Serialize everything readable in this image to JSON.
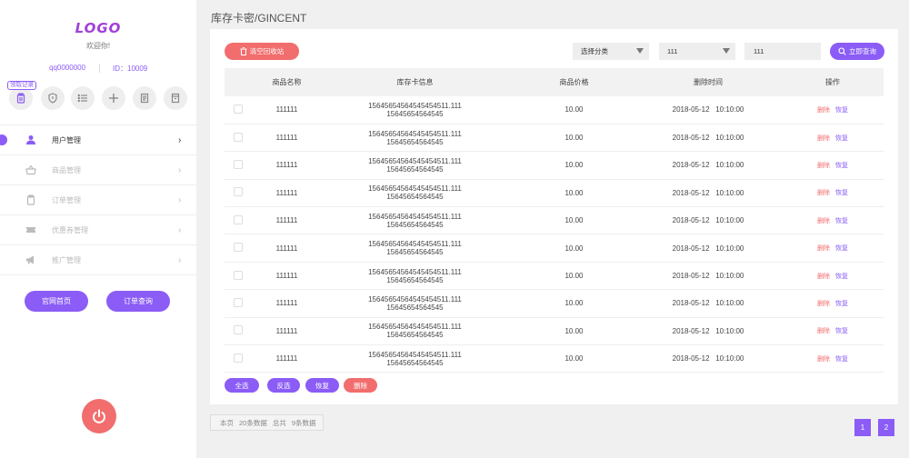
{
  "sidebar": {
    "logo": "LOGO",
    "welcome": "欢迎你!",
    "username": "qq0000000",
    "user_id": "ID：10009",
    "icon_badge": "领取记录",
    "icons": [
      "clipboard-icon",
      "shield-icon",
      "list-icon",
      "plus-icon",
      "document-icon",
      "bookmark-icon"
    ],
    "menu": [
      {
        "label": "用户管理",
        "icon": "user-icon",
        "active": true
      },
      {
        "label": "商品管理",
        "icon": "basket-icon",
        "active": false
      },
      {
        "label": "订单管理",
        "icon": "clipboard-icon",
        "active": false
      },
      {
        "label": "优惠券管理",
        "icon": "ticket-icon",
        "active": false
      },
      {
        "label": "推广管理",
        "icon": "megaphone-icon",
        "active": false
      }
    ],
    "buttons": {
      "home": "官网首页",
      "order_query": "订单查询"
    }
  },
  "page": {
    "title": "库存卡密/GINCENT"
  },
  "toolbar": {
    "clear_recycle": "清空回收站",
    "category_select": "选择分类",
    "second_select": "111",
    "search_value": "111",
    "search_button": "立即查询"
  },
  "table": {
    "headers": [
      "",
      "商品名称",
      "库存卡信息",
      "商品价格",
      "删除时间",
      "操作"
    ],
    "rows": [
      {
        "name": "111111",
        "card_line1": "15645654564545454511.111",
        "card_line2": "15645654564545",
        "price": "10.00",
        "time": "2018-05-12   10:10:00",
        "del": "删除",
        "recover": "恢复"
      },
      {
        "name": "111111",
        "card_line1": "15645654564545454511.111",
        "card_line2": "15645654564545",
        "price": "10.00",
        "time": "2018-05-12   10:10:00",
        "del": "删除",
        "recover": "恢复"
      },
      {
        "name": "111111",
        "card_line1": "15645654564545454511.111",
        "card_line2": "15645654564545",
        "price": "10.00",
        "time": "2018-05-12   10:10:00",
        "del": "删除",
        "recover": "恢复"
      },
      {
        "name": "111111",
        "card_line1": "15645654564545454511.111",
        "card_line2": "15645654564545",
        "price": "10.00",
        "time": "2018-05-12   10:10:00",
        "del": "删除",
        "recover": "恢复"
      },
      {
        "name": "111111",
        "card_line1": "15645654564545454511.111",
        "card_line2": "15645654564545",
        "price": "10.00",
        "time": "2018-05-12   10:10:00",
        "del": "删除",
        "recover": "恢复"
      },
      {
        "name": "111111",
        "card_line1": "15645654564545454511.111",
        "card_line2": "15645654564545",
        "price": "10.00",
        "time": "2018-05-12   10:10:00",
        "del": "删除",
        "recover": "恢复"
      },
      {
        "name": "111111",
        "card_line1": "15645654564545454511.111",
        "card_line2": "15645654564545",
        "price": "10.00",
        "time": "2018-05-12   10:10:00",
        "del": "删除",
        "recover": "恢复"
      },
      {
        "name": "111111",
        "card_line1": "15645654564545454511.111",
        "card_line2": "15645654564545",
        "price": "10.00",
        "time": "2018-05-12   10:10:00",
        "del": "删除",
        "recover": "恢复"
      },
      {
        "name": "111111",
        "card_line1": "15645654564545454511.111",
        "card_line2": "15645654564545",
        "price": "10.00",
        "time": "2018-05-12   10:10:00",
        "del": "删除",
        "recover": "恢复"
      },
      {
        "name": "111111",
        "card_line1": "15645654564545454511.111",
        "card_line2": "15645654564545",
        "price": "10.00",
        "time": "2018-05-12   10:10:00",
        "del": "删除",
        "recover": "恢复"
      }
    ]
  },
  "bulk_actions": {
    "select_all": "全选",
    "invert": "反选",
    "recover": "恢复",
    "delete": "删除"
  },
  "footer": {
    "page_label": "本页",
    "page_count": "20条数据",
    "total_label": "总共",
    "total_count": "9条数据"
  },
  "pagination": {
    "pages": [
      "1",
      "2"
    ]
  },
  "colors": {
    "accent": "#8b5cf6",
    "danger": "#f26d6d",
    "logo": "#a040d8"
  }
}
